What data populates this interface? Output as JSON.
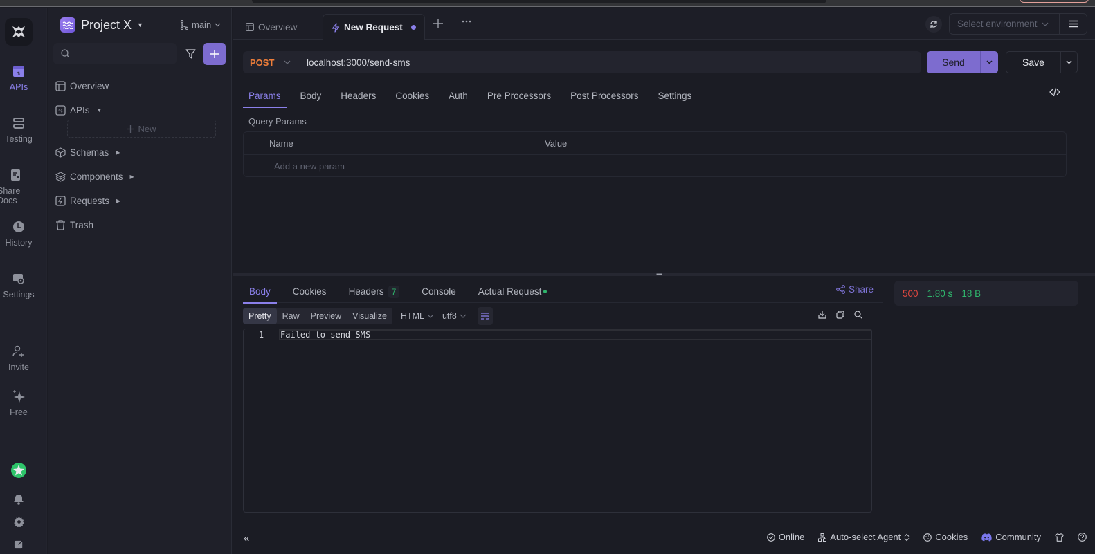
{
  "project": {
    "name": "Project X",
    "branch": "main"
  },
  "rail": {
    "items": [
      {
        "label": "APIs",
        "icon": "apis-icon",
        "active": true
      },
      {
        "label": "Testing",
        "icon": "testing-icon"
      },
      {
        "label": "Share Docs",
        "icon": "share-docs-icon"
      },
      {
        "label": "History",
        "icon": "history-icon"
      },
      {
        "label": "Settings",
        "icon": "settings-icon"
      }
    ],
    "bottom": [
      {
        "label": "Invite",
        "icon": "invite-icon"
      },
      {
        "label": "Free",
        "icon": "sparkle-icon"
      }
    ]
  },
  "sidebar": {
    "search_placeholder": "",
    "items": [
      {
        "label": "Overview",
        "icon": "layout-icon"
      },
      {
        "label": "APIs",
        "icon": "api-icon",
        "expanded": true
      },
      {
        "label": "Schemas",
        "icon": "cube-icon"
      },
      {
        "label": "Components",
        "icon": "layers-icon"
      },
      {
        "label": "Requests",
        "icon": "request-icon"
      },
      {
        "label": "Trash",
        "icon": "trash-icon"
      }
    ],
    "new_label": "New"
  },
  "tabs": {
    "overview": "Overview",
    "active": "New Request",
    "unsaved": true
  },
  "environment": {
    "placeholder": "Select environment"
  },
  "request": {
    "method": "POST",
    "url": "localhost:3000/send-sms",
    "send_label": "Send",
    "save_label": "Save",
    "tabs": [
      "Params",
      "Body",
      "Headers",
      "Cookies",
      "Auth",
      "Pre Processors",
      "Post Processors",
      "Settings"
    ],
    "active_tab": "Params",
    "query_params_label": "Query Params",
    "columns": [
      "Name",
      "Value"
    ],
    "add_param_placeholder": "Add a new param"
  },
  "response": {
    "tabs": {
      "body": "Body",
      "cookies": "Cookies",
      "headers": "Headers",
      "headers_count": "7",
      "console": "Console",
      "actual_request": "Actual Request"
    },
    "share_label": "Share",
    "formats": [
      "Pretty",
      "Raw",
      "Preview",
      "Visualize"
    ],
    "active_format": "Pretty",
    "content_type": "HTML",
    "encoding": "utf8",
    "lines": [
      {
        "n": "1",
        "text": "Failed to send SMS"
      }
    ],
    "status_code": "500",
    "time": "1.80 s",
    "size": "18 B",
    "colors": {
      "error": "#e0473f",
      "success": "#2fb56c",
      "accent": "#8b80ea"
    }
  },
  "statusbar": {
    "online": "Online",
    "agent": "Auto-select Agent",
    "cookies": "Cookies",
    "community": "Community"
  }
}
